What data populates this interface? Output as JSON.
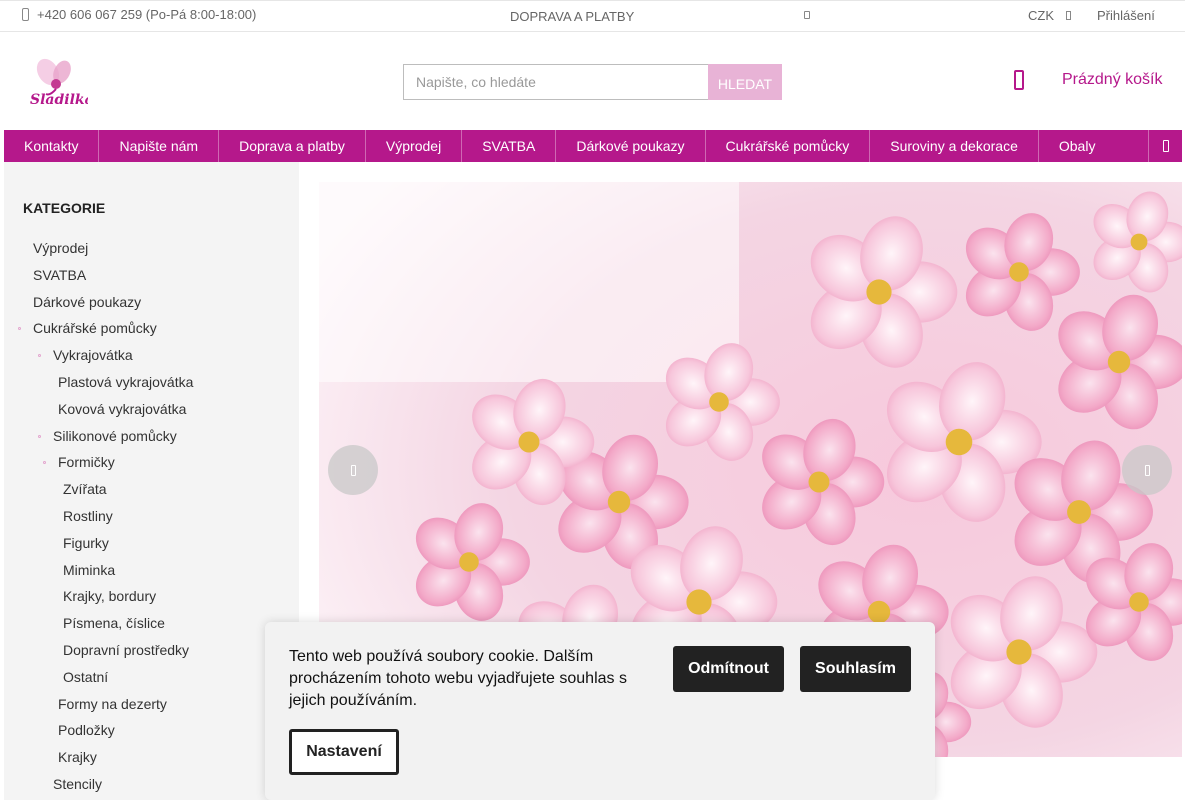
{
  "topbar": {
    "phone": "+420 606 067 259 (Po-Pá 8:00-18:00)",
    "shipping_link": "DOPRAVA A PLATBY",
    "currency": "CZK",
    "login": "Přihlášení"
  },
  "logo": {
    "text": "Sladilka"
  },
  "search": {
    "placeholder": "Napište, co hledáte",
    "button": "HLEDAT"
  },
  "cart": {
    "label": "Prázdný košík"
  },
  "nav": [
    "Kontakty",
    "Napište nám",
    "Doprava a platby",
    "Výprodej",
    "SVATBA",
    "Dárkové poukazy",
    "Cukrářské pomůcky",
    "Suroviny a dekorace",
    "Obaly"
  ],
  "sidebar": {
    "title": "KATEGORIE",
    "items": [
      {
        "label": "Výprodej",
        "level": 0,
        "expanded": false
      },
      {
        "label": "SVATBA",
        "level": 0,
        "expanded": false
      },
      {
        "label": "Dárkové poukazy",
        "level": 0,
        "expanded": false
      },
      {
        "label": "Cukrářské pomůcky",
        "level": 0,
        "expanded": true
      },
      {
        "label": "Vykrajovátka",
        "level": 1,
        "expanded": true
      },
      {
        "label": "Plastová vykrajovátka",
        "level": 2,
        "expanded": false
      },
      {
        "label": "Kovová vykrajovátka",
        "level": 2,
        "expanded": false
      },
      {
        "label": "Silikonové pomůcky",
        "level": 1,
        "expanded": true
      },
      {
        "label": "Formičky",
        "level": 2,
        "expanded": true
      },
      {
        "label": "Zvířata",
        "level": 3,
        "expanded": false
      },
      {
        "label": "Rostliny",
        "level": 3,
        "expanded": false
      },
      {
        "label": "Figurky",
        "level": 3,
        "expanded": false
      },
      {
        "label": "Miminka",
        "level": 3,
        "expanded": false
      },
      {
        "label": "Krajky, bordury",
        "level": 3,
        "expanded": false
      },
      {
        "label": "Písmena, číslice",
        "level": 3,
        "expanded": false
      },
      {
        "label": "Dopravní prostředky",
        "level": 3,
        "expanded": false
      },
      {
        "label": "Ostatní",
        "level": 3,
        "expanded": false
      },
      {
        "label": "Formy na dezerty",
        "level": 2,
        "expanded": false
      },
      {
        "label": "Podložky",
        "level": 2,
        "expanded": false
      },
      {
        "label": "Krajky",
        "level": 2,
        "expanded": false
      },
      {
        "label": "Stencily",
        "level": 1,
        "expanded": false
      }
    ]
  },
  "banner": {
    "image": "pink cherry blossom photo"
  },
  "cookie": {
    "message": "Tento web používá soubory cookie. Dalším procházením tohoto webu vyjadřujete souhlas s jejich používáním.",
    "reject": "Odmítnout",
    "accept": "Souhlasím",
    "settings": "Nastavení"
  },
  "colors": {
    "brand": "#b5188b",
    "search_button": "#e8b3d6",
    "sidebar_bg": "#f4f4f4"
  },
  "icons": {
    "phone": "phone-icon",
    "cart": "cart-icon",
    "currency_toggle": "chevron-down-icon",
    "nav_more": "menu-more-icon",
    "prev": "chevron-left-icon",
    "next": "chevron-right-icon"
  }
}
